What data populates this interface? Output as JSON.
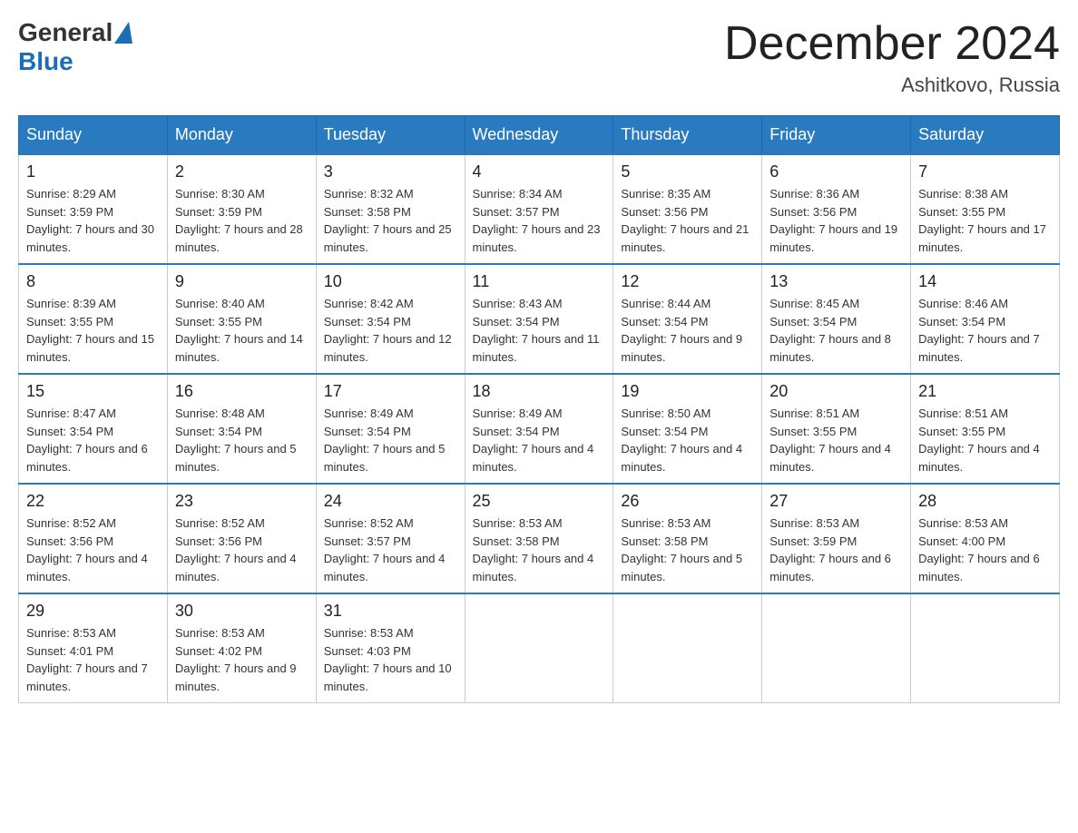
{
  "header": {
    "logo_general": "General",
    "logo_blue": "Blue",
    "month_title": "December 2024",
    "location": "Ashitkovo, Russia"
  },
  "days_of_week": [
    "Sunday",
    "Monday",
    "Tuesday",
    "Wednesday",
    "Thursday",
    "Friday",
    "Saturday"
  ],
  "weeks": [
    [
      {
        "day": "1",
        "sunrise": "Sunrise: 8:29 AM",
        "sunset": "Sunset: 3:59 PM",
        "daylight": "Daylight: 7 hours and 30 minutes."
      },
      {
        "day": "2",
        "sunrise": "Sunrise: 8:30 AM",
        "sunset": "Sunset: 3:59 PM",
        "daylight": "Daylight: 7 hours and 28 minutes."
      },
      {
        "day": "3",
        "sunrise": "Sunrise: 8:32 AM",
        "sunset": "Sunset: 3:58 PM",
        "daylight": "Daylight: 7 hours and 25 minutes."
      },
      {
        "day": "4",
        "sunrise": "Sunrise: 8:34 AM",
        "sunset": "Sunset: 3:57 PM",
        "daylight": "Daylight: 7 hours and 23 minutes."
      },
      {
        "day": "5",
        "sunrise": "Sunrise: 8:35 AM",
        "sunset": "Sunset: 3:56 PM",
        "daylight": "Daylight: 7 hours and 21 minutes."
      },
      {
        "day": "6",
        "sunrise": "Sunrise: 8:36 AM",
        "sunset": "Sunset: 3:56 PM",
        "daylight": "Daylight: 7 hours and 19 minutes."
      },
      {
        "day": "7",
        "sunrise": "Sunrise: 8:38 AM",
        "sunset": "Sunset: 3:55 PM",
        "daylight": "Daylight: 7 hours and 17 minutes."
      }
    ],
    [
      {
        "day": "8",
        "sunrise": "Sunrise: 8:39 AM",
        "sunset": "Sunset: 3:55 PM",
        "daylight": "Daylight: 7 hours and 15 minutes."
      },
      {
        "day": "9",
        "sunrise": "Sunrise: 8:40 AM",
        "sunset": "Sunset: 3:55 PM",
        "daylight": "Daylight: 7 hours and 14 minutes."
      },
      {
        "day": "10",
        "sunrise": "Sunrise: 8:42 AM",
        "sunset": "Sunset: 3:54 PM",
        "daylight": "Daylight: 7 hours and 12 minutes."
      },
      {
        "day": "11",
        "sunrise": "Sunrise: 8:43 AM",
        "sunset": "Sunset: 3:54 PM",
        "daylight": "Daylight: 7 hours and 11 minutes."
      },
      {
        "day": "12",
        "sunrise": "Sunrise: 8:44 AM",
        "sunset": "Sunset: 3:54 PM",
        "daylight": "Daylight: 7 hours and 9 minutes."
      },
      {
        "day": "13",
        "sunrise": "Sunrise: 8:45 AM",
        "sunset": "Sunset: 3:54 PM",
        "daylight": "Daylight: 7 hours and 8 minutes."
      },
      {
        "day": "14",
        "sunrise": "Sunrise: 8:46 AM",
        "sunset": "Sunset: 3:54 PM",
        "daylight": "Daylight: 7 hours and 7 minutes."
      }
    ],
    [
      {
        "day": "15",
        "sunrise": "Sunrise: 8:47 AM",
        "sunset": "Sunset: 3:54 PM",
        "daylight": "Daylight: 7 hours and 6 minutes."
      },
      {
        "day": "16",
        "sunrise": "Sunrise: 8:48 AM",
        "sunset": "Sunset: 3:54 PM",
        "daylight": "Daylight: 7 hours and 5 minutes."
      },
      {
        "day": "17",
        "sunrise": "Sunrise: 8:49 AM",
        "sunset": "Sunset: 3:54 PM",
        "daylight": "Daylight: 7 hours and 5 minutes."
      },
      {
        "day": "18",
        "sunrise": "Sunrise: 8:49 AM",
        "sunset": "Sunset: 3:54 PM",
        "daylight": "Daylight: 7 hours and 4 minutes."
      },
      {
        "day": "19",
        "sunrise": "Sunrise: 8:50 AM",
        "sunset": "Sunset: 3:54 PM",
        "daylight": "Daylight: 7 hours and 4 minutes."
      },
      {
        "day": "20",
        "sunrise": "Sunrise: 8:51 AM",
        "sunset": "Sunset: 3:55 PM",
        "daylight": "Daylight: 7 hours and 4 minutes."
      },
      {
        "day": "21",
        "sunrise": "Sunrise: 8:51 AM",
        "sunset": "Sunset: 3:55 PM",
        "daylight": "Daylight: 7 hours and 4 minutes."
      }
    ],
    [
      {
        "day": "22",
        "sunrise": "Sunrise: 8:52 AM",
        "sunset": "Sunset: 3:56 PM",
        "daylight": "Daylight: 7 hours and 4 minutes."
      },
      {
        "day": "23",
        "sunrise": "Sunrise: 8:52 AM",
        "sunset": "Sunset: 3:56 PM",
        "daylight": "Daylight: 7 hours and 4 minutes."
      },
      {
        "day": "24",
        "sunrise": "Sunrise: 8:52 AM",
        "sunset": "Sunset: 3:57 PM",
        "daylight": "Daylight: 7 hours and 4 minutes."
      },
      {
        "day": "25",
        "sunrise": "Sunrise: 8:53 AM",
        "sunset": "Sunset: 3:58 PM",
        "daylight": "Daylight: 7 hours and 4 minutes."
      },
      {
        "day": "26",
        "sunrise": "Sunrise: 8:53 AM",
        "sunset": "Sunset: 3:58 PM",
        "daylight": "Daylight: 7 hours and 5 minutes."
      },
      {
        "day": "27",
        "sunrise": "Sunrise: 8:53 AM",
        "sunset": "Sunset: 3:59 PM",
        "daylight": "Daylight: 7 hours and 6 minutes."
      },
      {
        "day": "28",
        "sunrise": "Sunrise: 8:53 AM",
        "sunset": "Sunset: 4:00 PM",
        "daylight": "Daylight: 7 hours and 6 minutes."
      }
    ],
    [
      {
        "day": "29",
        "sunrise": "Sunrise: 8:53 AM",
        "sunset": "Sunset: 4:01 PM",
        "daylight": "Daylight: 7 hours and 7 minutes."
      },
      {
        "day": "30",
        "sunrise": "Sunrise: 8:53 AM",
        "sunset": "Sunset: 4:02 PM",
        "daylight": "Daylight: 7 hours and 9 minutes."
      },
      {
        "day": "31",
        "sunrise": "Sunrise: 8:53 AM",
        "sunset": "Sunset: 4:03 PM",
        "daylight": "Daylight: 7 hours and 10 minutes."
      },
      {
        "day": "",
        "sunrise": "",
        "sunset": "",
        "daylight": ""
      },
      {
        "day": "",
        "sunrise": "",
        "sunset": "",
        "daylight": ""
      },
      {
        "day": "",
        "sunrise": "",
        "sunset": "",
        "daylight": ""
      },
      {
        "day": "",
        "sunrise": "",
        "sunset": "",
        "daylight": ""
      }
    ]
  ]
}
